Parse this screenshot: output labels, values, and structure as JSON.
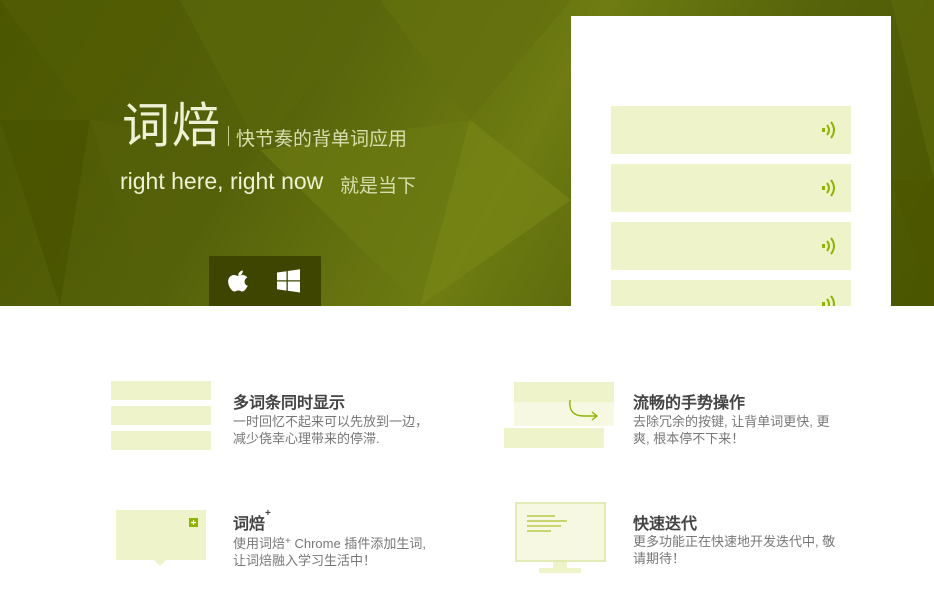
{
  "hero": {
    "app_name": "词焙",
    "tagline": "快节奏的背单词应用",
    "slogan": "right here, right now",
    "slogan_cn": "就是当下"
  },
  "platforms": [
    {
      "icon": "apple-icon"
    },
    {
      "icon": "windows-icon"
    }
  ],
  "phone_preview": {
    "cards": [
      {
        "icon": "speaker-icon"
      },
      {
        "icon": "speaker-icon"
      },
      {
        "icon": "speaker-icon"
      },
      {
        "icon": "speaker-icon"
      }
    ]
  },
  "features": [
    {
      "title": "多词条同时显示",
      "desc": "一时回忆不起来可以先放到一边，减少侥幸心理带来的停滞."
    },
    {
      "title": "流畅的手势操作",
      "desc": "去除冗余的按键, 让背单词更快, 更爽, 根本停不下来！"
    },
    {
      "title": "词焙",
      "title_sup": "+",
      "desc_a": "使用词焙",
      "desc_sup": "+",
      "desc_b": " Chrome 插件添加生词, 让词焙融入学习生活中！"
    },
    {
      "title": "快速迭代",
      "desc": "更多功能正在快速地开发迭代中, 敬请期待！"
    }
  ],
  "colors": {
    "hero_dark": "#4b5600",
    "hero_light": "#6e7c12",
    "card": "#eff3c9",
    "accent": "#8fb400",
    "platform_bar": "#3d4500"
  }
}
